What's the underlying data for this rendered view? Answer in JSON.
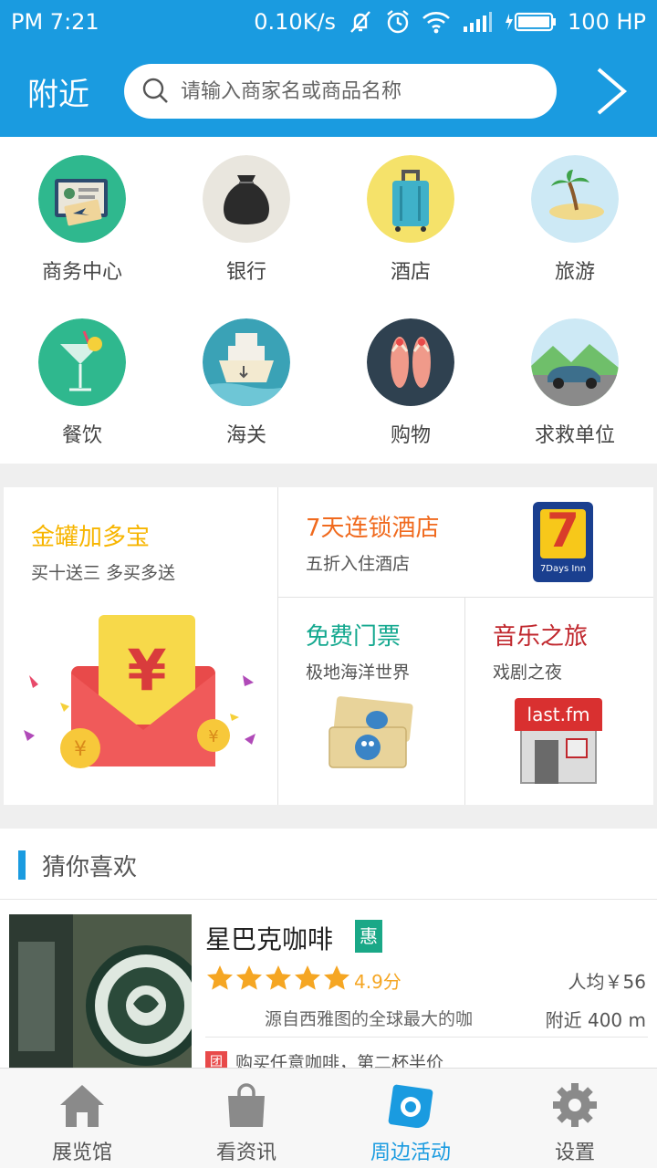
{
  "status_bar": {
    "time": "PM 7:21",
    "speed": "0.10K/s",
    "battery": "100 HP"
  },
  "header": {
    "title": "附近",
    "search_placeholder": "请输入商家名或商品名称"
  },
  "categories": [
    {
      "label": "商务中心",
      "icon": "business-center-icon"
    },
    {
      "label": "银行",
      "icon": "bank-icon"
    },
    {
      "label": "酒店",
      "icon": "hotel-icon"
    },
    {
      "label": "旅游",
      "icon": "travel-icon"
    },
    {
      "label": "餐饮",
      "icon": "dining-icon"
    },
    {
      "label": "海关",
      "icon": "customs-icon"
    },
    {
      "label": "购物",
      "icon": "shopping-icon"
    },
    {
      "label": "求救单位",
      "icon": "rescue-icon"
    }
  ],
  "promos": {
    "main": {
      "title": "金罐加多宝",
      "subtitle": "买十送三 多买多送",
      "color": "#f7b500"
    },
    "hotel": {
      "title": "7天连锁酒店",
      "subtitle": "五折入住酒店",
      "color": "#f06a1e",
      "logo_caption": "7Days Inn"
    },
    "tickets": {
      "title": "免费门票",
      "subtitle": "极地海洋世界",
      "color": "#14a88f"
    },
    "music": {
      "title": "音乐之旅",
      "subtitle": "戏剧之夜",
      "color": "#c0272d",
      "logo_text": "last.fm"
    }
  },
  "guess": {
    "heading": "猜你喜欢",
    "items": [
      {
        "name": "星巴克咖啡",
        "badge": "惠",
        "rating": 4.9,
        "score_text": "4.9分",
        "price": "人均￥56",
        "desc": "源自西雅图的全球最大的咖",
        "distance": "附近 400 m",
        "deal_badge": "团",
        "deal": "购买任意咖啡，第二杯半价"
      }
    ]
  },
  "tabs": [
    {
      "label": "展览馆",
      "icon": "home-icon",
      "active": false
    },
    {
      "label": "看资讯",
      "icon": "bag-icon",
      "active": false
    },
    {
      "label": "周边活动",
      "icon": "eye-icon",
      "active": true
    },
    {
      "label": "设置",
      "icon": "gear-icon",
      "active": false
    }
  ],
  "colors": {
    "primary": "#1a9be0",
    "star": "#f5a623"
  }
}
